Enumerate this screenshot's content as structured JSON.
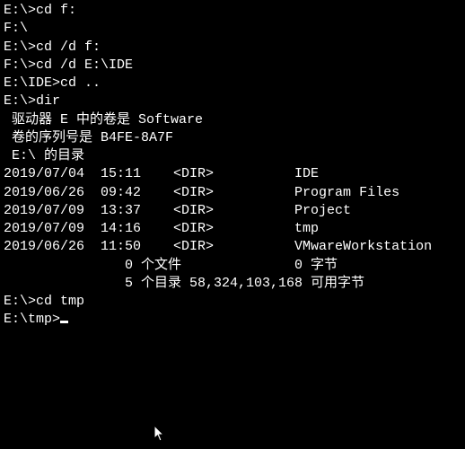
{
  "lines": [
    {
      "prompt": "E:\\>",
      "cmd": "cd f:"
    },
    {
      "text": "F:\\"
    },
    {
      "text": ""
    },
    {
      "prompt": "E:\\>",
      "cmd": "cd /d f:"
    },
    {
      "text": ""
    },
    {
      "prompt": "F:\\>",
      "cmd": "cd /d E:\\IDE"
    },
    {
      "text": ""
    },
    {
      "prompt": "E:\\IDE>",
      "cmd": "cd .."
    },
    {
      "text": ""
    },
    {
      "prompt": "E:\\>",
      "cmd": "dir"
    },
    {
      "text": " 驱动器 E 中的卷是 Software"
    },
    {
      "text": " 卷的序列号是 B4FE-8A7F"
    },
    {
      "text": ""
    },
    {
      "text": " E:\\ 的目录"
    },
    {
      "text": ""
    },
    {
      "text": "2019/07/04  15:11    <DIR>          IDE"
    },
    {
      "text": "2019/06/26  09:42    <DIR>          Program Files"
    },
    {
      "text": "2019/07/09  13:37    <DIR>          Project"
    },
    {
      "text": "2019/07/09  14:16    <DIR>          tmp"
    },
    {
      "text": "2019/06/26  11:50    <DIR>          VMwareWorkstation"
    },
    {
      "text": "               0 个文件              0 字节"
    },
    {
      "text": "               5 个目录 58,324,103,168 可用字节"
    },
    {
      "text": ""
    },
    {
      "prompt": "E:\\>",
      "cmd": "cd tmp"
    },
    {
      "text": ""
    },
    {
      "prompt": "E:\\tmp>",
      "cmd": "",
      "cursor": true
    }
  ],
  "dir_listing": {
    "drive": "E",
    "volume_label": "Software",
    "serial": "B4FE-8A7F",
    "path": "E:\\",
    "entries": [
      {
        "date": "2019/07/04",
        "time": "15:11",
        "type": "DIR",
        "name": "IDE"
      },
      {
        "date": "2019/06/26",
        "time": "09:42",
        "type": "DIR",
        "name": "Program Files"
      },
      {
        "date": "2019/07/09",
        "time": "13:37",
        "type": "DIR",
        "name": "Project"
      },
      {
        "date": "2019/07/09",
        "time": "14:16",
        "type": "DIR",
        "name": "tmp"
      },
      {
        "date": "2019/06/26",
        "time": "11:50",
        "type": "DIR",
        "name": "VMwareWorkstation"
      }
    ],
    "file_count": 0,
    "file_bytes": 0,
    "dir_count": 5,
    "free_bytes": 58324103168,
    "free_bytes_display": "58,324,103,168"
  },
  "colors": {
    "background": "#000000",
    "foreground": "#ffffff"
  }
}
